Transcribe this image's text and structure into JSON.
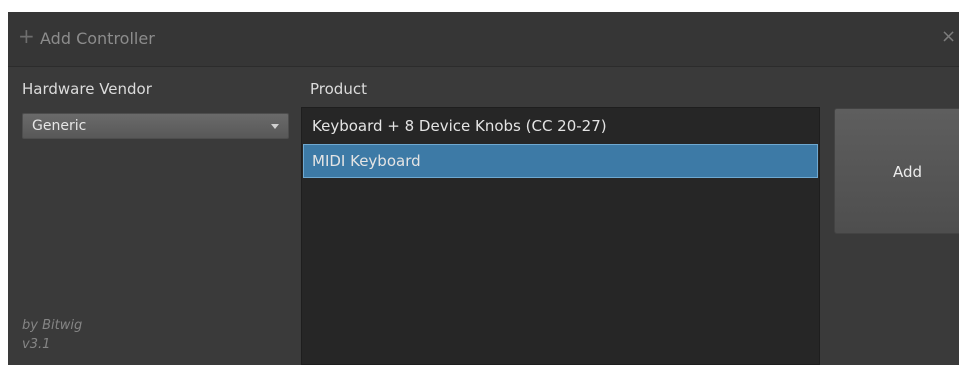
{
  "dialog": {
    "title_icon": "+",
    "title": "Add Controller",
    "close_icon": "×"
  },
  "vendor": {
    "label": "Hardware Vendor",
    "selected": "Generic"
  },
  "product": {
    "label": "Product",
    "items": [
      {
        "label": "Keyboard + 8 Device Knobs (CC 20-27)",
        "selected": false
      },
      {
        "label": "MIDI Keyboard",
        "selected": true
      }
    ]
  },
  "actions": {
    "add_label": "Add"
  },
  "footer": {
    "author": "by Bitwig",
    "version": "v3.1"
  },
  "colors": {
    "background": "#3a3a3a",
    "list_background": "#262626",
    "selection": "#3d7aa6"
  }
}
